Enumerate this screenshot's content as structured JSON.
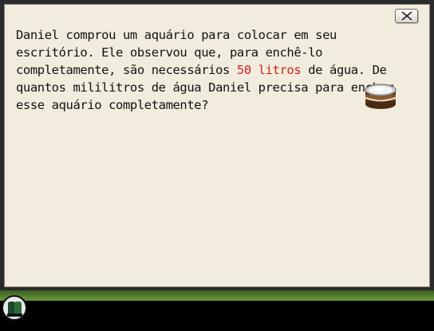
{
  "dialog": {
    "close_icon": "close-x-icon",
    "question": {
      "before_highlight": "Daniel comprou um aquário para colocar em seu escritório. Ele observou que, para enchê-lo completamente, são necessários ",
      "highlight": "50 litros",
      "after_highlight": " de água. De quantos mililitros de água Daniel precisa para encher esse aquário completamente?"
    },
    "highlight_color": "#d61c1c",
    "item_icon": "water-drum-icon"
  },
  "hud": {
    "logo_icon": "game-logo-icon"
  }
}
